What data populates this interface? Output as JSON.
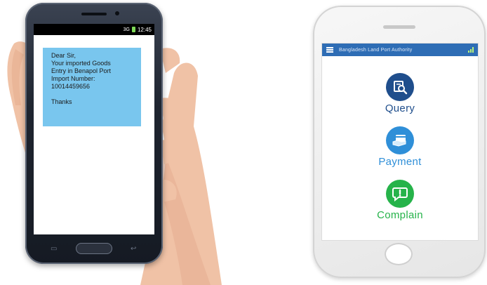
{
  "sms_phone": {
    "status_time": "12:45",
    "status_signal": "3G",
    "message_lines": [
      "Dear Sir,",
      "Your imported Goods",
      "Entry in Benapol Port",
      "Import Number:",
      "10014459656",
      "",
      "Thanks"
    ],
    "bubble_color": "#79c6ee"
  },
  "app_phone": {
    "app_title": "Bangladesh Land Port Authority",
    "app_bar_color": "#2e6db5",
    "menu": [
      {
        "label": "Query",
        "icon": "search-document-icon",
        "color": "#1f4e8c"
      },
      {
        "label": "Payment",
        "icon": "payment-card-icon",
        "color": "#2f8fd8"
      },
      {
        "label": "Complain",
        "icon": "alert-message-icon",
        "color": "#26b34a"
      }
    ]
  }
}
